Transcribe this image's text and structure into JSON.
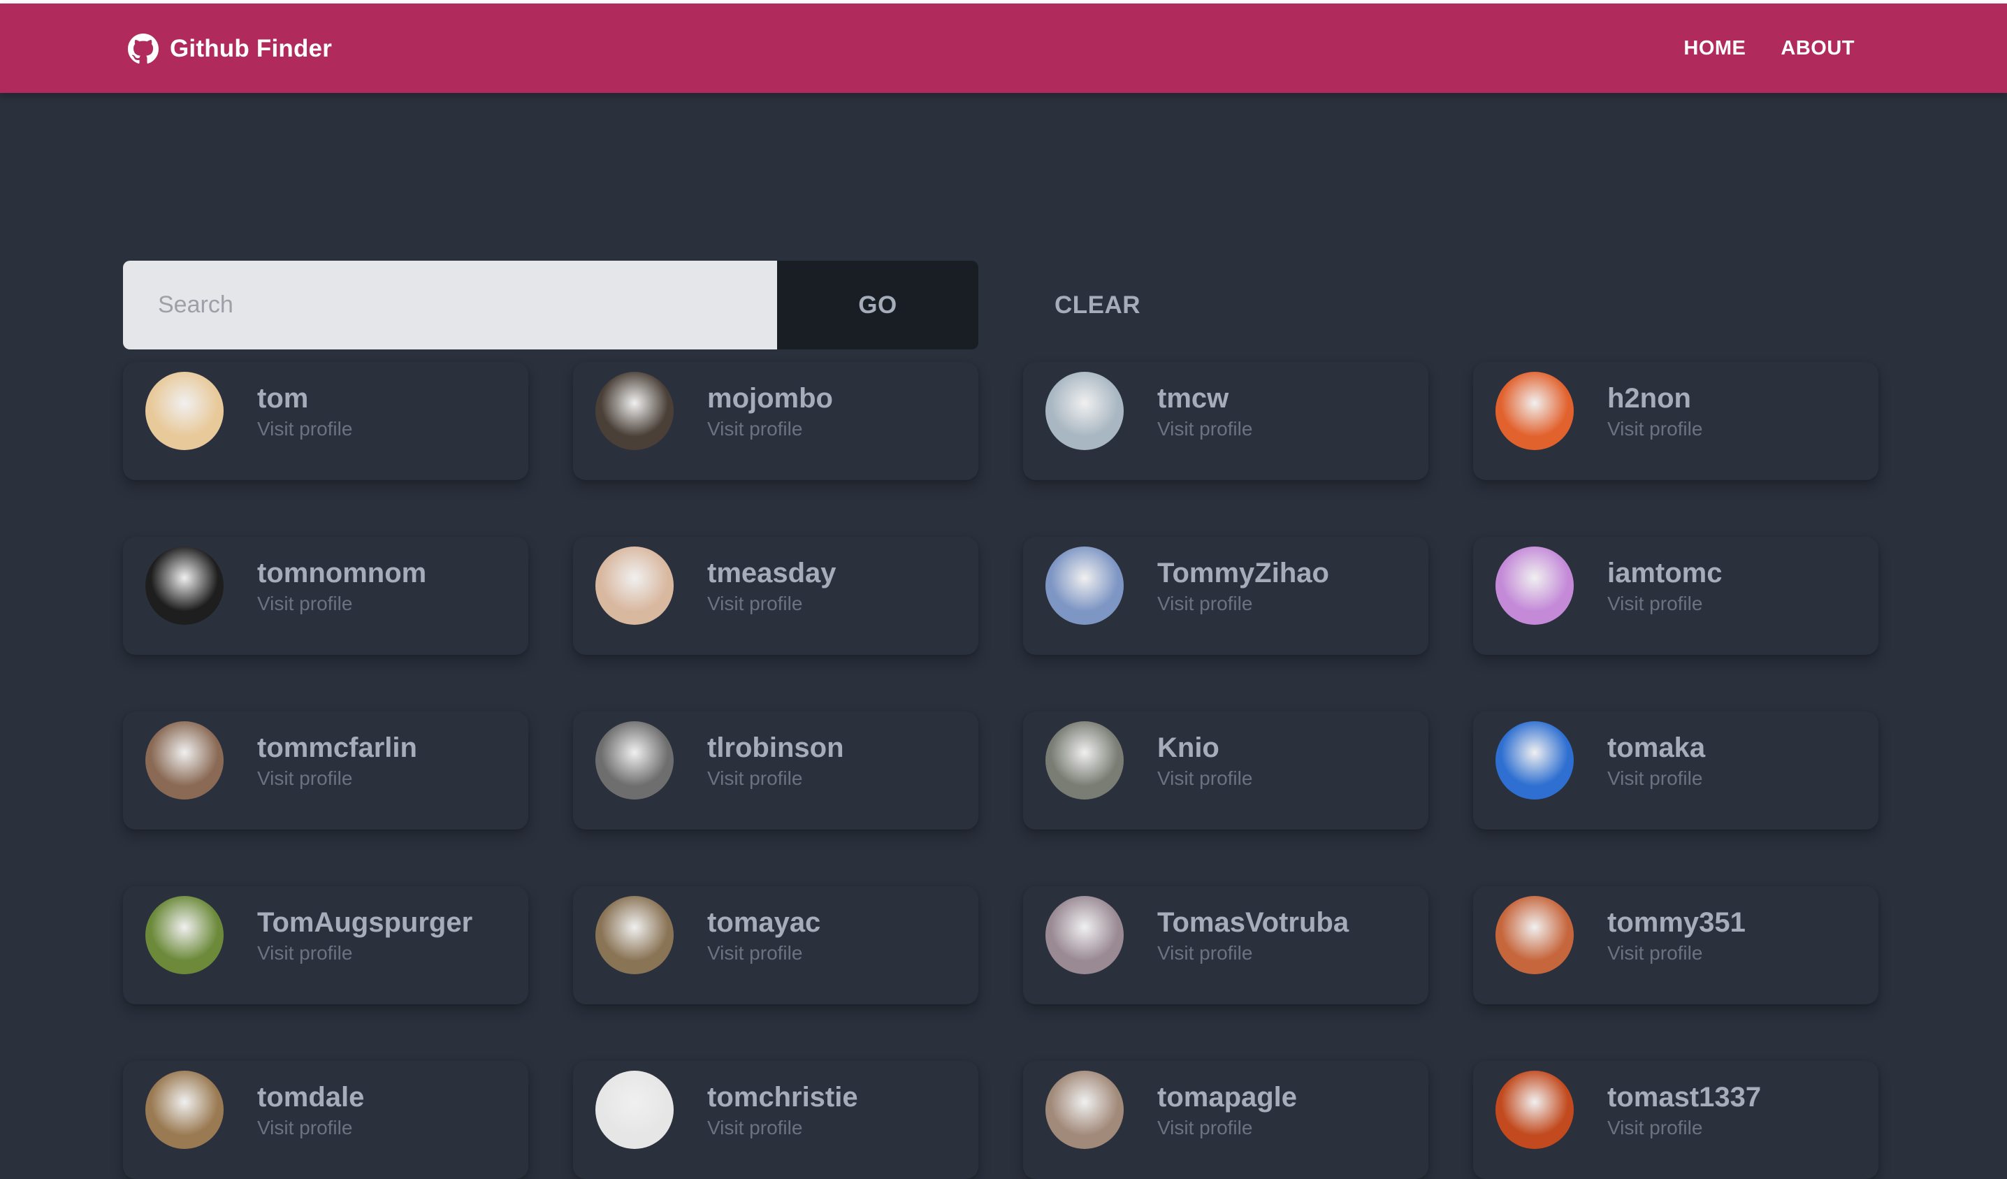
{
  "navbar": {
    "brand_icon": "github-icon",
    "brand_title": "Github Finder",
    "links": [
      "HOME",
      "ABOUT"
    ]
  },
  "search": {
    "placeholder": "Search",
    "value": "",
    "go_label": "GO",
    "clear_label": "CLEAR"
  },
  "colors": {
    "navbar": "#b02b5c",
    "background": "#2a303c",
    "go_button": "#191d24"
  },
  "users": [
    {
      "login": "tom",
      "link": "Visit profile",
      "avatar_color": "#e8c99a"
    },
    {
      "login": "mojombo",
      "link": "Visit profile",
      "avatar_color": "#4a4038"
    },
    {
      "login": "tmcw",
      "link": "Visit profile",
      "avatar_color": "#a9b7c2"
    },
    {
      "login": "h2non",
      "link": "Visit profile",
      "avatar_color": "#e2622e"
    },
    {
      "login": "tomnomnom",
      "link": "Visit profile",
      "avatar_color": "#1e1e1e"
    },
    {
      "login": "tmeasday",
      "link": "Visit profile",
      "avatar_color": "#d9b8a0"
    },
    {
      "login": "TommyZihao",
      "link": "Visit profile",
      "avatar_color": "#7e96c4"
    },
    {
      "login": "iamtomc",
      "link": "Visit profile",
      "avatar_color": "#c48ad8"
    },
    {
      "login": "tommcfarlin",
      "link": "Visit profile",
      "avatar_color": "#8a6a55"
    },
    {
      "login": "tlrobinson",
      "link": "Visit profile",
      "avatar_color": "#6e6e6e"
    },
    {
      "login": "Knio",
      "link": "Visit profile",
      "avatar_color": "#7a7d74"
    },
    {
      "login": "tomaka",
      "link": "Visit profile",
      "avatar_color": "#2e6fd1"
    },
    {
      "login": "TomAugspurger",
      "link": "Visit profile",
      "avatar_color": "#6c8a3a"
    },
    {
      "login": "tomayac",
      "link": "Visit profile",
      "avatar_color": "#8a7456"
    },
    {
      "login": "TomasVotruba",
      "link": "Visit profile",
      "avatar_color": "#9a8a94"
    },
    {
      "login": "tommy351",
      "link": "Visit profile",
      "avatar_color": "#c6663c"
    },
    {
      "login": "tomdale",
      "link": "Visit profile",
      "avatar_color": "#9a7a52"
    },
    {
      "login": "tomchristie",
      "link": "Visit profile",
      "avatar_color": "#e6e6e6"
    },
    {
      "login": "tomapagle",
      "link": "Visit profile",
      "avatar_color": "#a28a7a"
    },
    {
      "login": "tomast1337",
      "link": "Visit profile",
      "avatar_color": "#c24a1e"
    }
  ]
}
